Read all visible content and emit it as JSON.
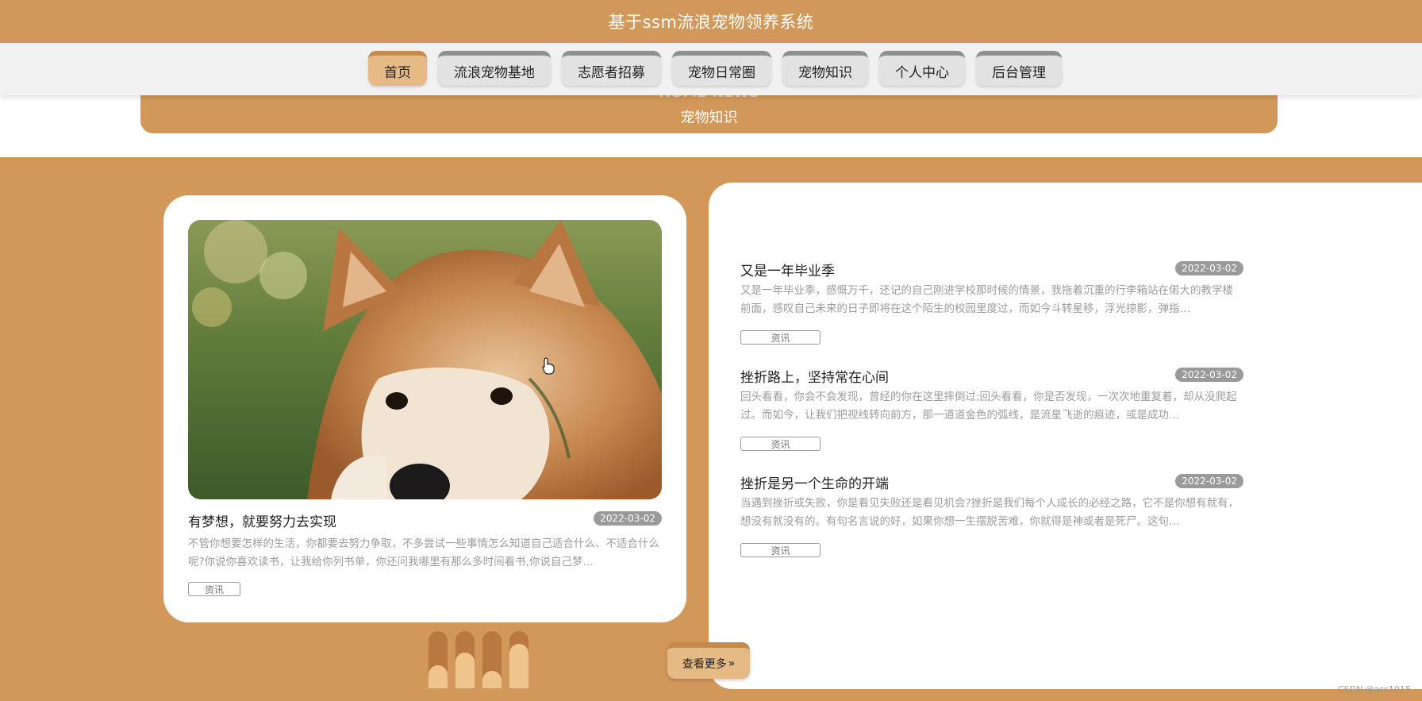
{
  "header": {
    "title": "基于ssm流浪宠物领养系统"
  },
  "nav": {
    "items": [
      {
        "label": "首页",
        "active": true
      },
      {
        "label": "流浪宠物基地",
        "active": false
      },
      {
        "label": "志愿者招募",
        "active": false
      },
      {
        "label": "宠物日常圈",
        "active": false
      },
      {
        "label": "宠物知识",
        "active": false
      },
      {
        "label": "个人中心",
        "active": false
      },
      {
        "label": "后台管理",
        "active": false
      }
    ]
  },
  "section": {
    "title_en": "HOME NEWS",
    "title_cn": "宠物知识"
  },
  "featured": {
    "image": "dog-photo",
    "title": "有梦想，就要努力去实现",
    "date": "2022-03-02",
    "summary": "不管你想要怎样的生活，你都要去努力争取，不多尝试一些事情怎么知道自己适合什么、不适合什么呢?你说你喜欢读书，让我给你列书单，你还问我哪里有那么多时间看书,你说自己梦…",
    "tag": "资讯"
  },
  "news": [
    {
      "title": "又是一年毕业季",
      "date": "2022-03-02",
      "summary": "又是一年毕业季，感慨万千，还记的自己刚进学校那时候的情景，我拖着沉重的行李箱站在偌大的教学楼前面，感叹自己未来的日子即将在这个陌生的校园里度过，而如今斗转星移，浮光掠影，弹指…",
      "tag": "资讯"
    },
    {
      "title": "挫折路上，坚持常在心间",
      "date": "2022-03-02",
      "summary": "回头看看，你会不会发现，曾经的你在这里摔倒过;回头看看，你是否发现，一次次地重复着，却从没爬起过。而如今，让我们把视线转向前方，那一道道金色的弧线，是流星飞逝的痕迹，或是成功…",
      "tag": "资讯"
    },
    {
      "title": "挫折是另一个生命的开端",
      "date": "2022-03-02",
      "summary": "当遇到挫折或失败，你是看见失败还是看见机会?挫折是我们每个人成长的必经之路，它不是你想有就有，想没有就没有的。有句名言说的好，如果你想一生摆脱苦难，你就得是神或者是死尸。这句…",
      "tag": "资讯"
    }
  ],
  "carousel": {
    "levels": [
      0.4,
      0.63,
      0.3,
      0.78
    ]
  },
  "more_button": {
    "label": "查看更多"
  },
  "watermark": "CSDN @ass1015",
  "colors": {
    "brand": "#d19859",
    "active_tab": "#e6ba85",
    "date_badge": "#9a9a9a"
  }
}
